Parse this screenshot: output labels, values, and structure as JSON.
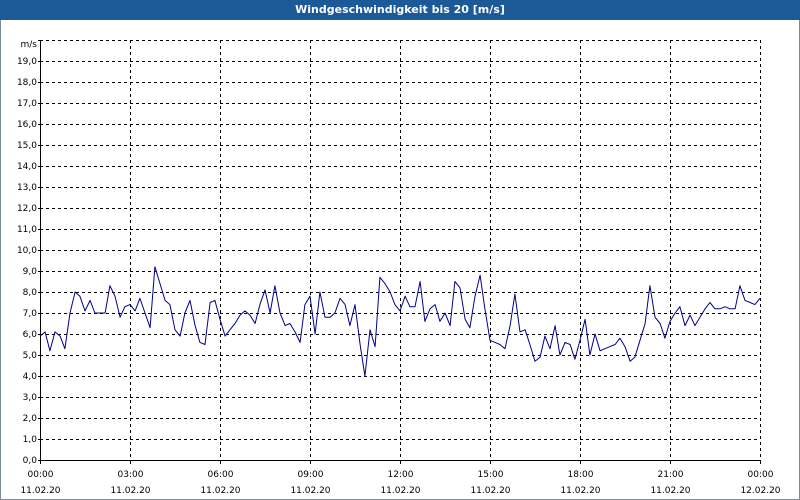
{
  "window": {
    "title": "Windgeschwindigkeit bis 20 [m/s]"
  },
  "chart_data": {
    "type": "line",
    "title": "Windgeschwindigkeit bis 20 [m/s]",
    "ylabel": "m/s",
    "ylim": [
      0,
      20
    ],
    "xlim": [
      0,
      24
    ],
    "grid": true,
    "y_ticks": [
      "0,0",
      "1,0",
      "2,0",
      "3,0",
      "4,0",
      "5,0",
      "6,0",
      "7,0",
      "8,0",
      "9,0",
      "10,0",
      "11,0",
      "12,0",
      "13,0",
      "14,0",
      "15,0",
      "16,0",
      "17,0",
      "18,0",
      "19,0"
    ],
    "x_ticks": [
      {
        "time": "00:00",
        "date": "11.02.20"
      },
      {
        "time": "03:00",
        "date": "11.02.20"
      },
      {
        "time": "06:00",
        "date": "11.02.20"
      },
      {
        "time": "09:00",
        "date": "11.02.20"
      },
      {
        "time": "12:00",
        "date": "11.02.20"
      },
      {
        "time": "15:00",
        "date": "11.02.20"
      },
      {
        "time": "18:00",
        "date": "11.02.20"
      },
      {
        "time": "21:00",
        "date": "11.02.20"
      },
      {
        "time": "00:00",
        "date": "12.02.20"
      }
    ],
    "series": [
      {
        "color": "#00008b",
        "x": [
          0.0,
          0.17,
          0.33,
          0.5,
          0.67,
          0.83,
          1.0,
          1.17,
          1.33,
          1.5,
          1.67,
          1.83,
          2.0,
          2.17,
          2.33,
          2.5,
          2.67,
          2.83,
          3.0,
          3.17,
          3.33,
          3.5,
          3.67,
          3.83,
          4.0,
          4.17,
          4.33,
          4.5,
          4.67,
          4.83,
          5.0,
          5.17,
          5.33,
          5.5,
          5.67,
          5.83,
          6.0,
          6.17,
          6.33,
          6.5,
          6.67,
          6.83,
          7.0,
          7.17,
          7.33,
          7.5,
          7.67,
          7.83,
          8.0,
          8.17,
          8.33,
          8.5,
          8.67,
          8.83,
          9.0,
          9.17,
          9.33,
          9.5,
          9.67,
          9.83,
          10.0,
          10.17,
          10.33,
          10.5,
          10.67,
          10.83,
          11.0,
          11.17,
          11.33,
          11.5,
          11.67,
          11.83,
          12.0,
          12.17,
          12.33,
          12.5,
          12.67,
          12.83,
          13.0,
          13.17,
          13.33,
          13.5,
          13.67,
          13.83,
          14.0,
          14.17,
          14.33,
          14.5,
          14.67,
          14.83,
          15.0,
          15.17,
          15.33,
          15.5,
          15.67,
          15.83,
          16.0,
          16.17,
          16.33,
          16.5,
          16.67,
          16.83,
          17.0,
          17.17,
          17.33,
          17.5,
          17.67,
          17.83,
          18.0,
          18.17,
          18.33,
          18.5,
          18.67,
          18.83,
          19.0,
          19.17,
          19.33,
          19.5,
          19.67,
          19.83,
          20.0,
          20.17,
          20.33,
          20.5,
          20.67,
          20.83,
          21.0,
          21.17,
          21.33,
          21.5,
          21.67,
          21.83,
          22.0,
          22.17,
          22.33,
          22.5,
          22.67,
          22.83,
          23.0,
          23.17,
          23.33,
          23.5,
          23.67,
          23.83,
          24.0
        ],
        "y": [
          5.9,
          6.1,
          5.2,
          6.1,
          5.9,
          5.3,
          7.0,
          8.0,
          7.8,
          7.1,
          7.6,
          7.0,
          7.0,
          7.0,
          8.3,
          7.8,
          6.8,
          7.3,
          7.4,
          7.1,
          7.7,
          7.0,
          6.3,
          9.2,
          8.4,
          7.6,
          7.4,
          6.2,
          5.9,
          7.0,
          7.6,
          6.4,
          5.6,
          5.5,
          7.5,
          7.6,
          6.7,
          5.9,
          6.2,
          6.5,
          6.9,
          7.1,
          6.9,
          6.5,
          7.4,
          8.1,
          7.0,
          8.3,
          7.0,
          6.4,
          6.5,
          6.1,
          5.6,
          7.4,
          7.8,
          6.0,
          8.0,
          6.8,
          6.8,
          7.0,
          7.7,
          7.4,
          6.4,
          7.4,
          5.5,
          4.0,
          6.2,
          5.4,
          8.7,
          8.4,
          8.0,
          7.4,
          7.1,
          7.8,
          7.3,
          7.3,
          8.5,
          6.6,
          7.2,
          7.4,
          6.6,
          7.0,
          6.4,
          8.5,
          8.2,
          6.7,
          6.3,
          7.8,
          8.8,
          7.2,
          5.7,
          5.6,
          5.5,
          5.3,
          6.4,
          7.9,
          6.1,
          6.2,
          5.5,
          4.7,
          4.9,
          5.9,
          5.3,
          6.4,
          5.0,
          5.6,
          5.5,
          4.8,
          5.7,
          6.7,
          5.0,
          6.0,
          5.2,
          5.3,
          5.4,
          5.5,
          5.8,
          5.4,
          4.7,
          4.9,
          5.7,
          6.5,
          8.3,
          6.8,
          6.5,
          5.8,
          6.6,
          7.0,
          7.3,
          6.4,
          6.9,
          6.4,
          6.8,
          7.2,
          7.5,
          7.2,
          7.2,
          7.3,
          7.2,
          7.2,
          8.3,
          7.6,
          7.5,
          7.4,
          7.7
        ]
      }
    ]
  }
}
